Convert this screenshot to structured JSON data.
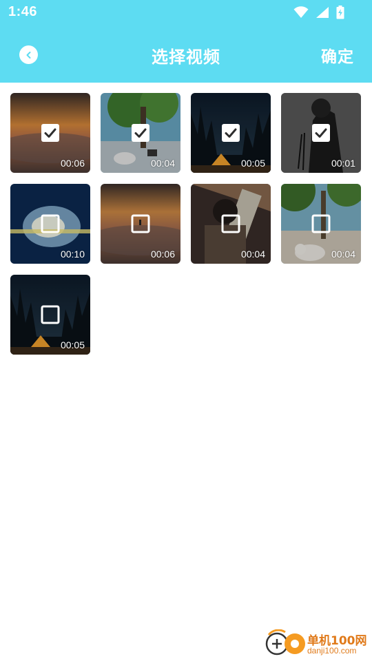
{
  "status_bar": {
    "time": "1:46",
    "icons": [
      "wifi-icon",
      "signal-icon",
      "battery-charging-icon"
    ]
  },
  "header": {
    "title": "选择视频",
    "confirm_label": "确定",
    "back_icon": "chevron-left-icon",
    "background_color": "#5ddcf2"
  },
  "videos": [
    {
      "duration": "00:06",
      "selected": true,
      "scene": "sunset-clouds"
    },
    {
      "duration": "00:04",
      "selected": true,
      "scene": "tree-beach-dog"
    },
    {
      "duration": "00:05",
      "selected": true,
      "scene": "night-tent"
    },
    {
      "duration": "00:01",
      "selected": true,
      "scene": "dark-figure"
    },
    {
      "duration": "00:10",
      "selected": false,
      "scene": "blue-explosion"
    },
    {
      "duration": "00:06",
      "selected": false,
      "scene": "sunset-clouds-person"
    },
    {
      "duration": "00:04",
      "selected": false,
      "scene": "anime-character"
    },
    {
      "duration": "00:04",
      "selected": false,
      "scene": "beach-dog"
    },
    {
      "duration": "00:05",
      "selected": false,
      "scene": "night-tent"
    }
  ],
  "watermark": {
    "brand": "单机100网",
    "url": "danji100.com"
  }
}
